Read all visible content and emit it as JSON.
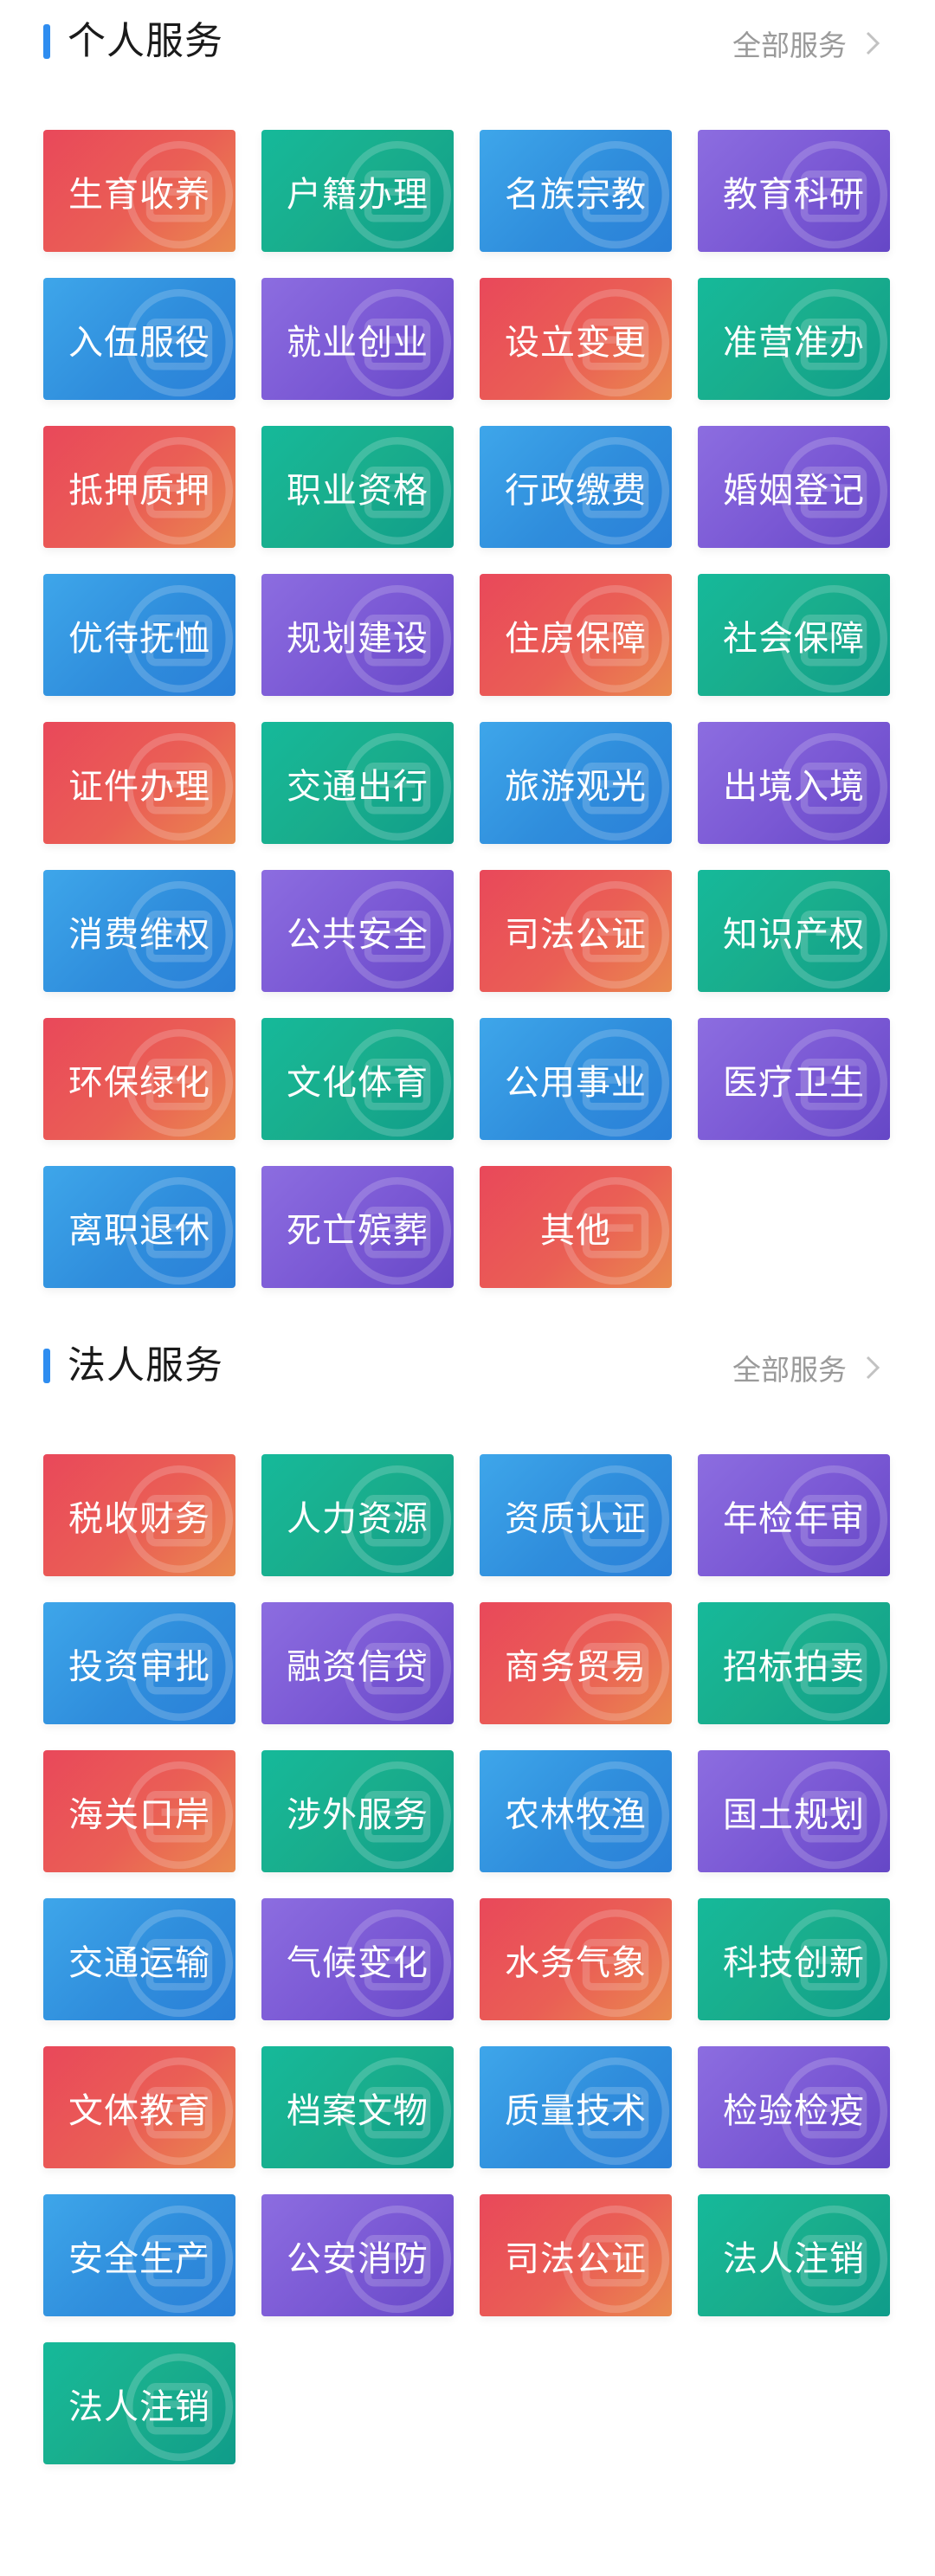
{
  "personal": {
    "title": "个人服务",
    "more_label": "全部服务",
    "items": [
      {
        "label": "生育收养",
        "color": "red",
        "icon": "family-icon"
      },
      {
        "label": "户籍办理",
        "color": "green",
        "icon": "id-card-icon"
      },
      {
        "label": "名族宗教",
        "color": "blue",
        "icon": "temple-icon"
      },
      {
        "label": "教育科研",
        "color": "purple",
        "icon": "flask-icon"
      },
      {
        "label": "入伍服役",
        "color": "blue",
        "icon": "medal-icon"
      },
      {
        "label": "就业创业",
        "color": "purple",
        "icon": "briefcase-icon"
      },
      {
        "label": "设立变更",
        "color": "red",
        "icon": "document-icon"
      },
      {
        "label": "准营准办",
        "color": "green",
        "icon": "license-icon"
      },
      {
        "label": "抵押质押",
        "color": "red",
        "icon": "house-icon"
      },
      {
        "label": "职业资格",
        "color": "green",
        "icon": "certificate-icon"
      },
      {
        "label": "行政缴费",
        "color": "blue",
        "icon": "payment-icon"
      },
      {
        "label": "婚姻登记",
        "color": "purple",
        "icon": "heart-icon"
      },
      {
        "label": "优待抚恤",
        "color": "blue",
        "icon": "care-icon"
      },
      {
        "label": "规划建设",
        "color": "purple",
        "icon": "building-icon"
      },
      {
        "label": "住房保障",
        "color": "red",
        "icon": "home-icon"
      },
      {
        "label": "社会保障",
        "color": "green",
        "icon": "shield-icon"
      },
      {
        "label": "证件办理",
        "color": "red",
        "icon": "card-icon"
      },
      {
        "label": "交通出行",
        "color": "green",
        "icon": "car-icon"
      },
      {
        "label": "旅游观光",
        "color": "blue",
        "icon": "palm-icon"
      },
      {
        "label": "出境入境",
        "color": "purple",
        "icon": "plane-icon"
      },
      {
        "label": "消费维权",
        "color": "blue",
        "icon": "cart-icon"
      },
      {
        "label": "公共安全",
        "color": "purple",
        "icon": "police-icon"
      },
      {
        "label": "司法公证",
        "color": "red",
        "icon": "gavel-icon"
      },
      {
        "label": "知识产权",
        "color": "green",
        "icon": "bulb-icon"
      },
      {
        "label": "环保绿化",
        "color": "red",
        "icon": "sun-icon"
      },
      {
        "label": "文化体育",
        "color": "green",
        "icon": "ball-icon"
      },
      {
        "label": "公用事业",
        "color": "blue",
        "icon": "utility-icon"
      },
      {
        "label": "医疗卫生",
        "color": "purple",
        "icon": "medical-icon"
      },
      {
        "label": "离职退休",
        "color": "blue",
        "icon": "elder-icon"
      },
      {
        "label": "死亡殡葬",
        "color": "purple",
        "icon": "flower-icon"
      },
      {
        "label": "其他",
        "color": "red",
        "icon": "calendar-icon"
      }
    ]
  },
  "legal": {
    "title": "法人服务",
    "more_label": "全部服务",
    "items": [
      {
        "label": "税收财务",
        "color": "red",
        "icon": "tax-icon"
      },
      {
        "label": "人力资源",
        "color": "green",
        "icon": "people-icon"
      },
      {
        "label": "资质认证",
        "color": "blue",
        "icon": "seal-icon"
      },
      {
        "label": "年检年审",
        "color": "purple",
        "icon": "magnifier-icon"
      },
      {
        "label": "投资审批",
        "color": "blue",
        "icon": "chart-icon"
      },
      {
        "label": "融资信贷",
        "color": "purple",
        "icon": "coin-icon"
      },
      {
        "label": "商务贸易",
        "color": "red",
        "icon": "trade-icon"
      },
      {
        "label": "招标拍卖",
        "color": "green",
        "icon": "hammer-icon"
      },
      {
        "label": "海关口岸",
        "color": "red",
        "icon": "ship-icon"
      },
      {
        "label": "涉外服务",
        "color": "green",
        "icon": "globe-icon"
      },
      {
        "label": "农林牧渔",
        "color": "blue",
        "icon": "plant-icon"
      },
      {
        "label": "国土规划",
        "color": "purple",
        "icon": "crane-icon"
      },
      {
        "label": "交通运输",
        "color": "blue",
        "icon": "truck-icon"
      },
      {
        "label": "气候变化",
        "color": "purple",
        "icon": "cloud-icon"
      },
      {
        "label": "水务气象",
        "color": "red",
        "icon": "snow-icon"
      },
      {
        "label": "科技创新",
        "color": "green",
        "icon": "atom-icon"
      },
      {
        "label": "文体教育",
        "color": "red",
        "icon": "book-icon"
      },
      {
        "label": "档案文物",
        "color": "green",
        "icon": "archive-icon"
      },
      {
        "label": "质量技术",
        "color": "blue",
        "icon": "badge-icon"
      },
      {
        "label": "检验检疫",
        "color": "purple",
        "icon": "microscope-icon"
      },
      {
        "label": "安全生产",
        "color": "blue",
        "icon": "helmet-icon"
      },
      {
        "label": "公安消防",
        "color": "purple",
        "icon": "fire-icon"
      },
      {
        "label": "司法公证",
        "color": "red",
        "icon": "gavel-icon"
      },
      {
        "label": "法人注销",
        "color": "green",
        "icon": "stamp-icon"
      },
      {
        "label": "法人注销",
        "color": "green",
        "icon": "stamp-icon"
      }
    ]
  }
}
